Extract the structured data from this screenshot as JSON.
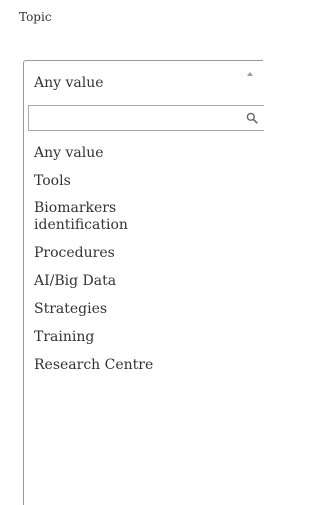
{
  "field": {
    "label": "Topic"
  },
  "select": {
    "current_value": "Any value",
    "search_placeholder": "",
    "options": [
      "Any value",
      "Tools",
      "Biomarkers\nidentification",
      "Procedures",
      "AI/Big Data",
      "Strategies",
      "Training",
      "Research Centre"
    ]
  },
  "icons": {
    "search": "search-icon",
    "arrow": "chevron-up-icon"
  },
  "colors": {
    "text": "#333333",
    "border": "#9a9a9a"
  }
}
